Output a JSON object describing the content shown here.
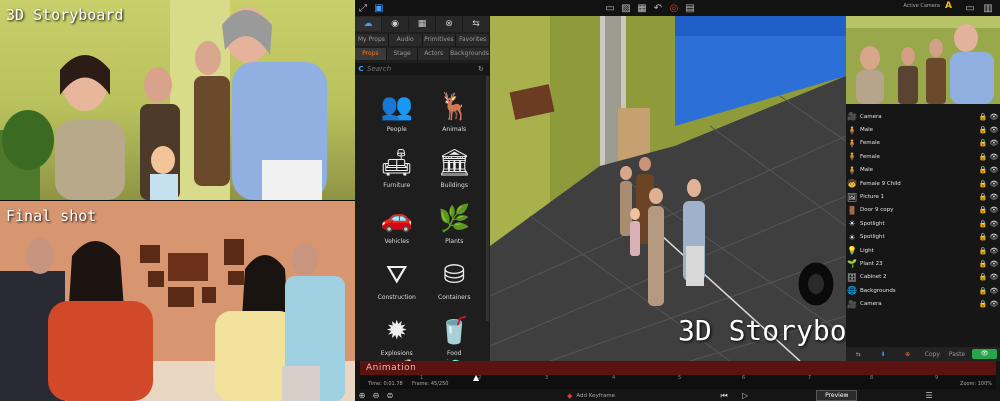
{
  "panels": {
    "top_label": "3D Storyboard",
    "bottom_label": "Final shot"
  },
  "app": {
    "active_camera_label": "Active Camera",
    "active_camera_letter": "A",
    "library_tabs_row1": [
      "My Props",
      "Audio",
      "Primitives",
      "Favorites"
    ],
    "library_tabs_row2": [
      "Props",
      "Stage",
      "Actors",
      "Backgrounds"
    ],
    "active_tab": "Props",
    "search": {
      "prefix": "C",
      "placeholder": "Search"
    },
    "library_items": [
      {
        "label": "People",
        "icon": "people-icon",
        "glyph": "👥"
      },
      {
        "label": "Animals",
        "icon": "deer-icon",
        "glyph": "🦌"
      },
      {
        "label": "Furniture",
        "icon": "armchair-icon",
        "glyph": "🛋"
      },
      {
        "label": "Buildings",
        "icon": "building-icon",
        "glyph": "🏛"
      },
      {
        "label": "Vehicles",
        "icon": "car-icon",
        "glyph": "🚗"
      },
      {
        "label": "Plants",
        "icon": "plant-icon",
        "glyph": "🌿"
      },
      {
        "label": "Construction",
        "icon": "cone-icon",
        "glyph": "⛛"
      },
      {
        "label": "Containers",
        "icon": "crate-icon",
        "glyph": "⛁"
      },
      {
        "label": "Explosions",
        "icon": "burst-icon",
        "glyph": "✹"
      },
      {
        "label": "Food",
        "icon": "food-icon",
        "glyph": "🥤"
      },
      {
        "label": "",
        "icon": "guitar-icon",
        "glyph": "🎸"
      },
      {
        "label": "",
        "icon": "saucer-icon",
        "glyph": "🛸"
      }
    ],
    "viewport_overlay": "3D Storyboard",
    "outliner": [
      {
        "name": "Camera",
        "icon": "camera-icon",
        "glyph": "🎥"
      },
      {
        "name": "Male",
        "icon": "male-icon",
        "glyph": "🧍"
      },
      {
        "name": "Female",
        "icon": "female-icon",
        "glyph": "🧍"
      },
      {
        "name": "Female",
        "icon": "female-icon",
        "glyph": "🧍"
      },
      {
        "name": "Male",
        "icon": "male-icon",
        "glyph": "🧍"
      },
      {
        "name": "Female 9 Child",
        "icon": "child-icon",
        "glyph": "🧒"
      },
      {
        "name": "Picture 1",
        "icon": "picture-icon",
        "glyph": "🖼"
      },
      {
        "name": "Door 9 copy",
        "icon": "door-icon",
        "glyph": "🚪"
      },
      {
        "name": "Spotlight",
        "icon": "spotlight-icon",
        "glyph": "☀"
      },
      {
        "name": "Spotlight",
        "icon": "spotlight-icon",
        "glyph": "☀"
      },
      {
        "name": "Light",
        "icon": "light-icon",
        "glyph": "💡"
      },
      {
        "name": "Plant 23",
        "icon": "plant-icon",
        "glyph": "🌱"
      },
      {
        "name": "Cabinet 2",
        "icon": "cabinet-icon",
        "glyph": "🗄"
      },
      {
        "name": "Backgrounds",
        "icon": "backgrounds-icon",
        "glyph": "🌐"
      },
      {
        "name": "Camera",
        "icon": "camera-icon",
        "glyph": "🎥"
      }
    ],
    "rp_buttons": [
      "Copy",
      "Paste"
    ],
    "timeline": {
      "title": "Animation",
      "time": "Time: 0:01.78",
      "frame": "Frame: 45/250",
      "zoom": "Zoom: 100%",
      "ticks": [
        "1",
        "2",
        "3",
        "4",
        "5",
        "6",
        "7",
        "8",
        "9"
      ],
      "add_keyframe": "Add Keyframe",
      "preview": "Preview"
    }
  }
}
